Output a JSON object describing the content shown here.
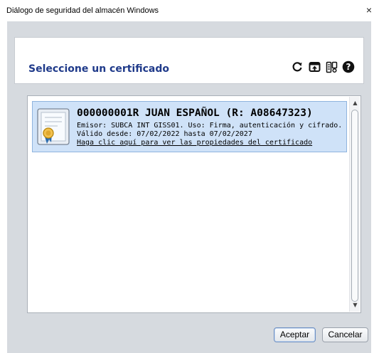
{
  "window": {
    "title": "Diálogo de seguridad del almacén Windows",
    "close_label": "×"
  },
  "header": {
    "title": "Seleccione un certificado",
    "toolbar_icons": [
      "refresh-icon",
      "import-icon",
      "details-icon",
      "help-icon"
    ]
  },
  "certificates": [
    {
      "name": "000000001R JUAN ESPAÑOL (R: A08647323)",
      "issuer_line": "Emisor: SUBCA INT GISS01. Uso: Firma, autenticación y cifrado.",
      "validity_line": "Válido desde: 07/02/2022 hasta 07/02/2027",
      "link_text": "Haga clic aquí para ver las propiedades del certificado",
      "selected": true
    }
  ],
  "buttons": {
    "accept": "Aceptar",
    "cancel": "Cancelar"
  },
  "colors": {
    "header_title": "#1f3a8a",
    "selection_bg": "#cfe2f8",
    "dialog_bg": "#d6dadf"
  }
}
